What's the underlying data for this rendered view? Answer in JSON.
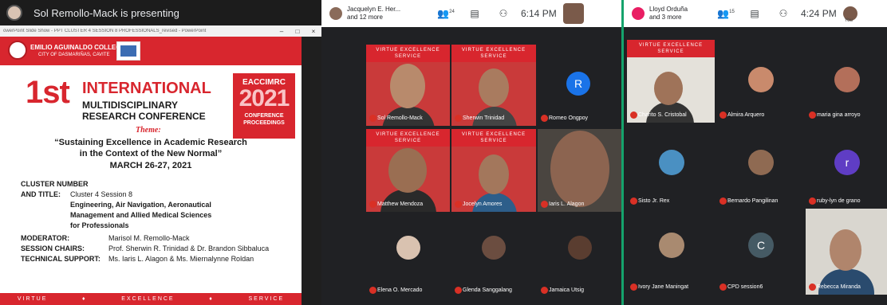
{
  "presenter": {
    "banner_text": "Sol Remollo-Mack is presenting",
    "powerpoint_title": "owerPoint Slide Show - PPT CLUSTER 4 SESSION 8 PROFESSIONALS_revised - PowerPoint",
    "ctrl_minimize": "–",
    "ctrl_restore": "□",
    "ctrl_close": "×"
  },
  "slide": {
    "college_name": "EMILIO AGUINALDO COLLEGE",
    "college_city": "CITY OF DASMARIÑAS, CAVITE",
    "big_first": "1st",
    "international": "INTERNATIONAL",
    "multidisciplinary": "MULTIDISCIPLINARY",
    "research_conference": "RESEARCH CONFERENCE",
    "eac_title": "EACCIMRC",
    "eac_year": "2021",
    "eac_sub1": "CONFERENCE",
    "eac_sub2": "PROCEEDINGS",
    "theme_label": "Theme:",
    "theme_line1": "“Sustaining Excellence in Academic Research",
    "theme_line2": "in the Context of the New Normal”",
    "dates": "MARCH 26-27, 2021",
    "cluster_number_label": "CLUSTER NUMBER",
    "and_title_label": "AND TITLE:",
    "and_title_value": "Cluster 4 Session 8",
    "title_line1": "Engineering, Air Navigation,  Aeronautical",
    "title_line2": "Management and Allied Medical Sciences",
    "title_line3": "for Professionals",
    "moderator_label": "MODERATOR:",
    "moderator_value": "Marisol M. Remollo-Mack",
    "chairs_label": "SESSION CHAIRS:",
    "chairs_value": "Prof. Sherwin R. Trinidad & Dr. Brandon Sibbaluca",
    "tech_label": "TECHNICAL SUPPORT:",
    "tech_value": "Ms. Iaris L. Alagon & Ms. Miernalynne Roldan",
    "footer": [
      "VIRTUE",
      "♦",
      "EXCELLENCE",
      "♦",
      "SERVICE"
    ]
  },
  "meet_left": {
    "top_names_line1": "Jacquelyn E. Her...",
    "top_names_line2": "and 12 more",
    "participants_count": "24",
    "time": "6:14 PM",
    "tiles": [
      {
        "name": "Sol Remollo-Mack",
        "banner": "VIRTUE EXCELLENCE SERVICE"
      },
      {
        "name": "Sherwin Trinidad",
        "banner": "VIRTUE EXCELLENCE SERVICE"
      },
      {
        "name": "Romeo Ongpoy",
        "letter": "R"
      },
      {
        "name": "Matthew Mendoza",
        "banner": "VIRTUE EXCELLENCE SERVICE"
      },
      {
        "name": "Jocelyn Amores",
        "banner": "VIRTUE EXCELLENCE SERVICE"
      },
      {
        "name": "Iaris L. Alagon"
      },
      {
        "name": "Elena O. Mercado"
      },
      {
        "name": "Glenda Sanggalang"
      },
      {
        "name": "Jamaica Utsig"
      }
    ]
  },
  "meet_right": {
    "top_names_line1": "Lloyd Orduña",
    "top_names_line2": "and 3 more",
    "participants_count": "15",
    "time": "4:24 PM",
    "you_label": "You",
    "tiles": [
      {
        "name": "Charito S. Cristobal",
        "banner": "VIRTUE EXCELLENCE SERVICE"
      },
      {
        "name": "Almira Arquero"
      },
      {
        "name": "maria gina arroyo"
      },
      {
        "name": "Sisto Jr. Rex"
      },
      {
        "name": "Bernardo Pangilinan"
      },
      {
        "name": "ruby-lyn de grano",
        "letter": "r"
      },
      {
        "name": "Ivory Jane Maningat"
      },
      {
        "name": "CPD session6",
        "letter": "C"
      },
      {
        "name": "Rebecca Miranda"
      }
    ]
  },
  "colors": {
    "brand_red": "#d8262e",
    "meet_bg": "#202124",
    "tile_bg": "#3c4043",
    "divider_green": "#15a36c"
  }
}
